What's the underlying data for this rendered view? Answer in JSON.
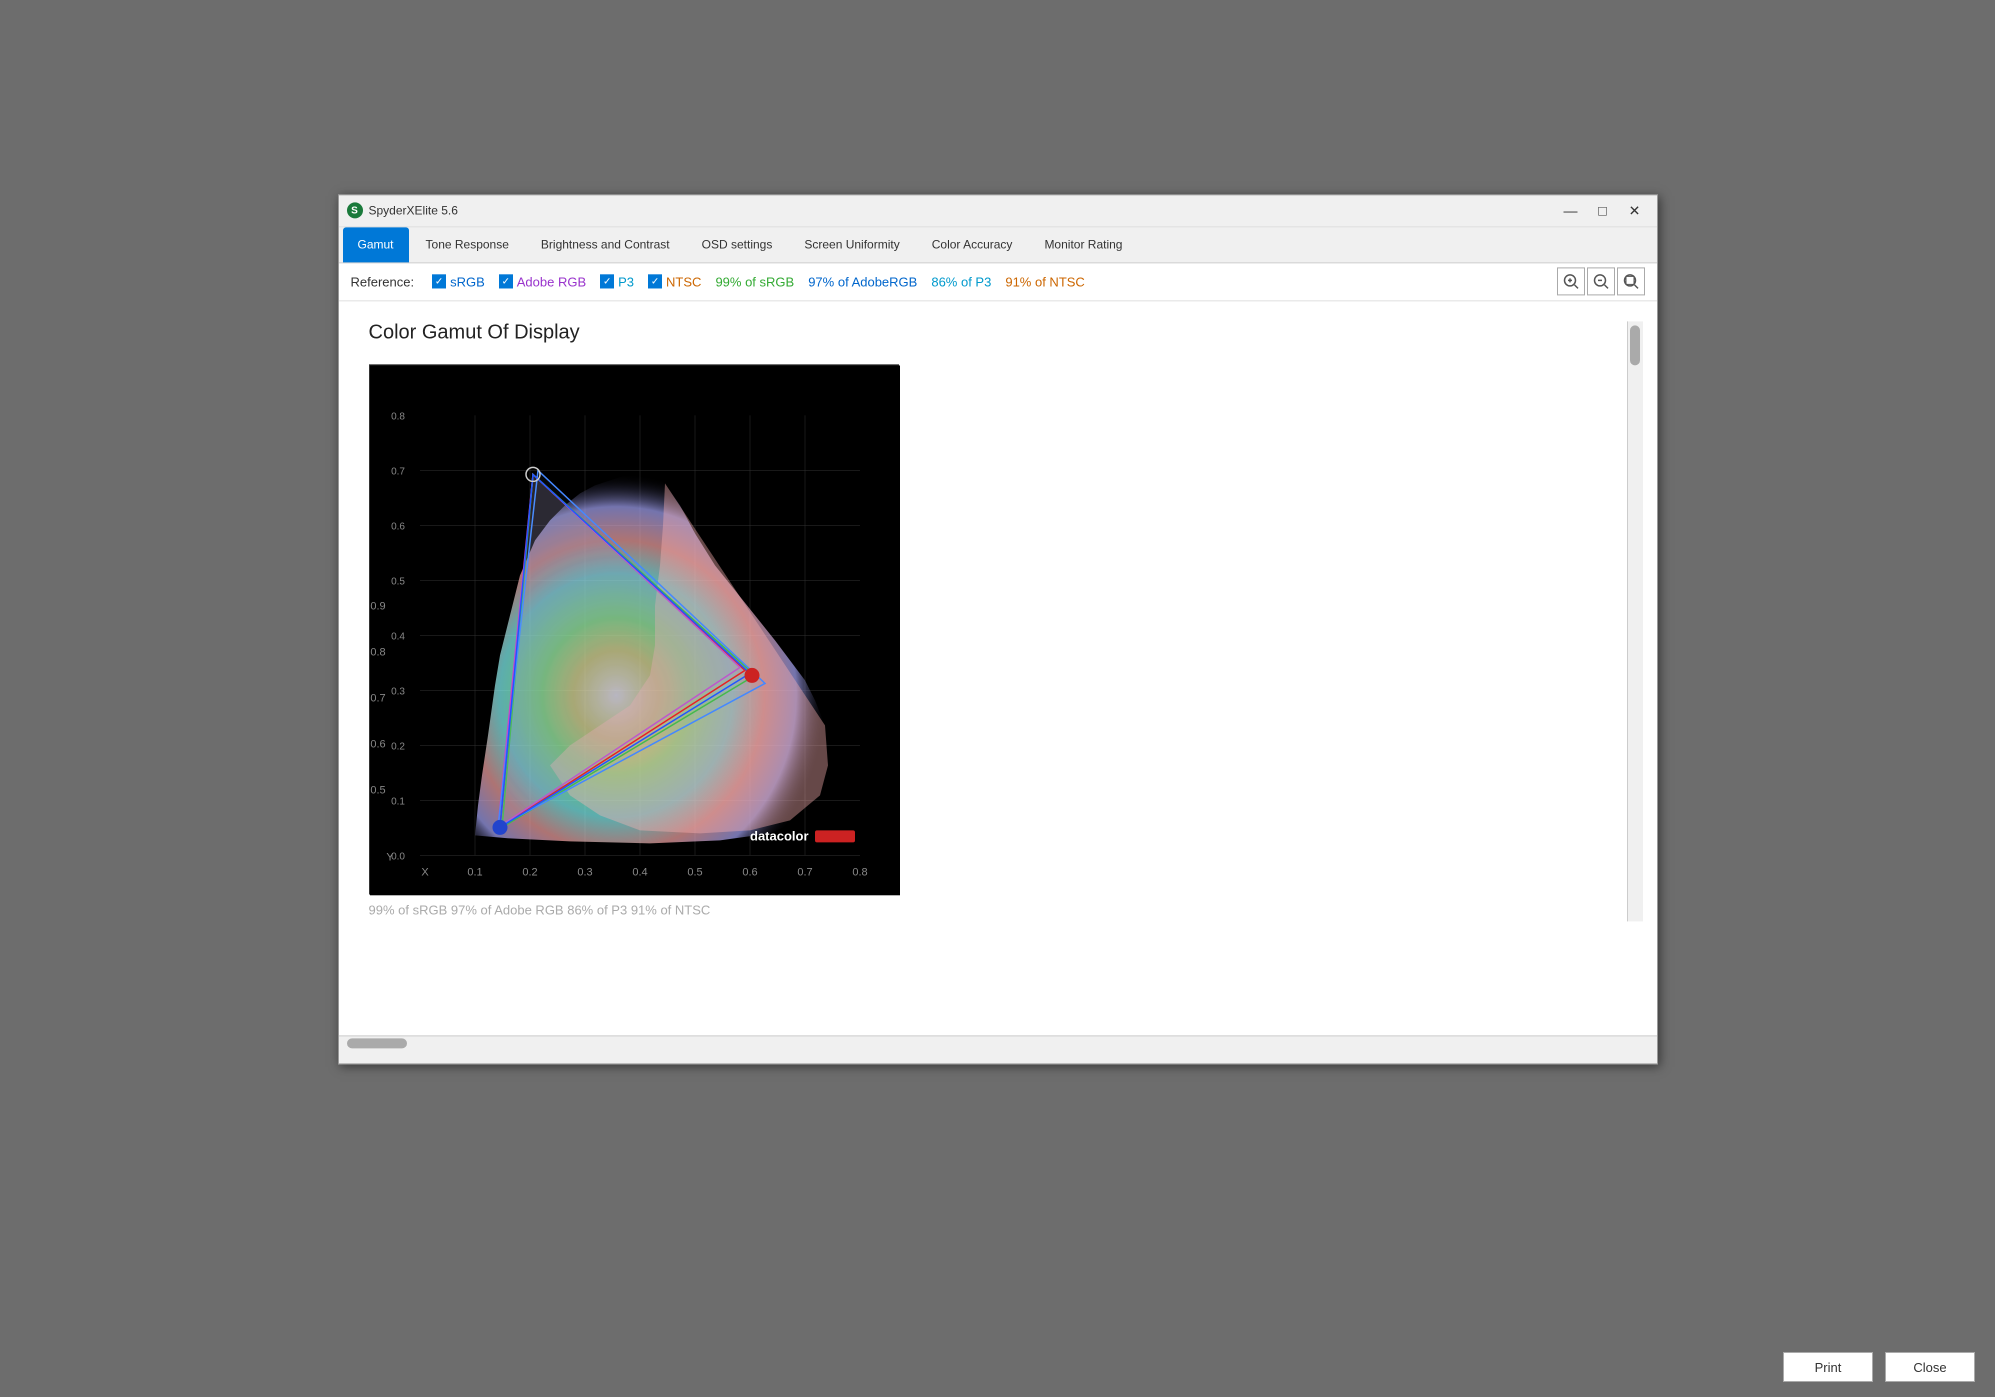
{
  "app": {
    "title": "SpyderXElite 5.6",
    "icon_label": "S"
  },
  "window_controls": {
    "minimize": "—",
    "maximize": "□",
    "close": "✕"
  },
  "nav": {
    "tabs": [
      {
        "id": "gamut",
        "label": "Gamut",
        "active": true
      },
      {
        "id": "tone",
        "label": "Tone Response",
        "active": false
      },
      {
        "id": "brightness",
        "label": "Brightness and Contrast",
        "active": false
      },
      {
        "id": "osd",
        "label": "OSD settings",
        "active": false
      },
      {
        "id": "uniformity",
        "label": "Screen Uniformity",
        "active": false
      },
      {
        "id": "color_accuracy",
        "label": "Color Accuracy",
        "active": false
      },
      {
        "id": "monitor_rating",
        "label": "Monitor Rating",
        "active": false
      }
    ]
  },
  "reference_bar": {
    "label": "Reference:",
    "items": [
      {
        "id": "srgb",
        "label": "sRGB",
        "checked": true
      },
      {
        "id": "adobe_rgb",
        "label": "Adobe RGB",
        "checked": true
      },
      {
        "id": "p3",
        "label": "P3",
        "checked": true
      },
      {
        "id": "ntsc",
        "label": "NTSC",
        "checked": true
      }
    ],
    "stats": [
      {
        "id": "srgb_stat",
        "value": "99% of sRGB"
      },
      {
        "id": "adobe_stat",
        "value": "97% of AdobeRGB"
      },
      {
        "id": "p3_stat",
        "value": "86% of P3"
      },
      {
        "id": "ntsc_stat",
        "value": "91% of NTSC"
      }
    ],
    "zoom_in": "+",
    "zoom_out": "−",
    "zoom_fit": "⊡"
  },
  "content": {
    "title": "Color Gamut Of Display"
  },
  "bottom_bar": {
    "text": "99% of sRGB  97% of Adobe RGB  86% of P3  91% of NTSC",
    "print_label": "Print",
    "close_label": "Close"
  },
  "datacolor_logo": "datacolor"
}
